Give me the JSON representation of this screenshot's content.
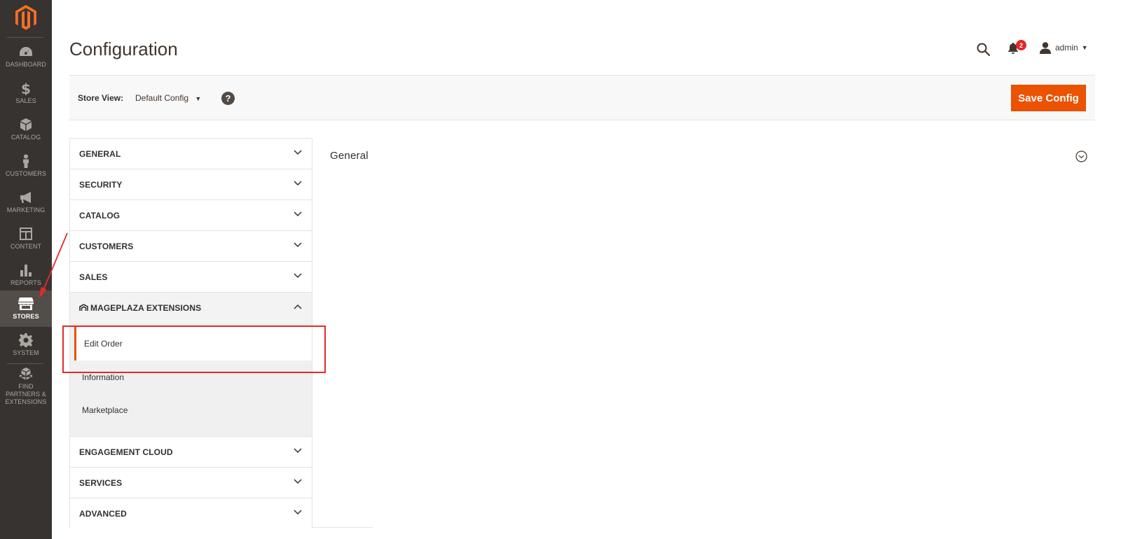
{
  "sidebar": {
    "logo": "magento-logo",
    "items": [
      {
        "label": "DASHBOARD",
        "icon": "dashboard-icon",
        "active": false
      },
      {
        "label": "SALES",
        "icon": "dollar-icon",
        "active": false
      },
      {
        "label": "CATALOG",
        "icon": "box-icon",
        "active": false
      },
      {
        "label": "CUSTOMERS",
        "icon": "person-icon",
        "active": false
      },
      {
        "label": "MARKETING",
        "icon": "megaphone-icon",
        "active": false
      },
      {
        "label": "CONTENT",
        "icon": "layout-icon",
        "active": false
      },
      {
        "label": "REPORTS",
        "icon": "bar-chart-icon",
        "active": false
      },
      {
        "label": "STORES",
        "icon": "store-icon",
        "active": true
      },
      {
        "label": "SYSTEM",
        "icon": "gear-icon",
        "active": false
      },
      {
        "label": "FIND PARTNERS & EXTENSIONS",
        "icon": "cubes-icon",
        "active": false
      }
    ]
  },
  "header": {
    "title": "Configuration",
    "notifications_count": "2",
    "user": "admin"
  },
  "store_bar": {
    "label": "Store View:",
    "selected": "Default Config",
    "help": "?",
    "save_label": "Save Config"
  },
  "tabs": {
    "general": "GENERAL",
    "security": "SECURITY",
    "catalog": "CATALOG",
    "customers": "CUSTOMERS",
    "sales": "SALES",
    "mageplaza": "MAGEPLAZA EXTENSIONS",
    "mageplaza_items": [
      "Edit Order",
      "Information",
      "Marketplace"
    ],
    "engagement": "ENGAGEMENT CLOUD",
    "services": "SERVICES",
    "advanced": "ADVANCED"
  },
  "section": {
    "title": "General"
  },
  "colors": {
    "sidebar_bg": "#373330",
    "accent": "#eb5202",
    "annotation": "#e42a2a"
  }
}
